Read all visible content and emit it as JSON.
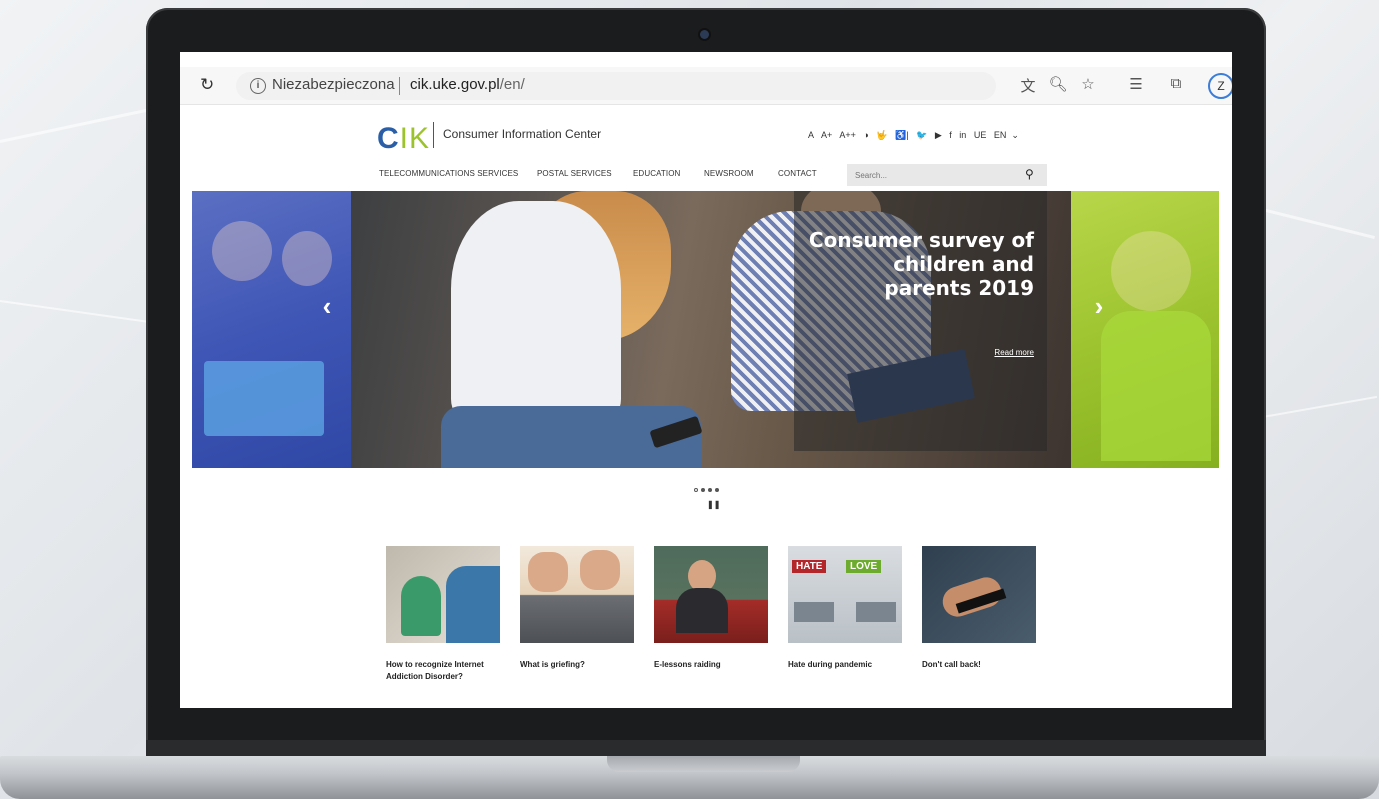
{
  "browser": {
    "security_label": "Niezabezpieczona",
    "url_host": "cik.uke.gov.pl",
    "url_path": "/en/",
    "profile_initial": "Z",
    "icons": [
      "reload-icon",
      "info-icon",
      "translate-icon",
      "zoom-icon",
      "favorite-icon",
      "favorites-list-icon",
      "collections-icon"
    ]
  },
  "site": {
    "logo_c": "C",
    "logo_ik": "IK",
    "logo_text": "Consumer Information Center",
    "tools": {
      "font_small": "A",
      "font_medium": "A+",
      "font_large": "A++",
      "contrast": "◑",
      "sign_language": "🤟",
      "wcag": "♿|",
      "social": [
        "🐦",
        "▶",
        "f",
        "in"
      ],
      "ue": "UE",
      "language": "EN"
    },
    "nav": [
      {
        "label": "TELECOMMUNICATIONS SERVICES"
      },
      {
        "label": "POSTAL SERVICES"
      },
      {
        "label": "EDUCATION"
      },
      {
        "label": "NEWSROOM"
      },
      {
        "label": "CONTACT"
      }
    ],
    "search_placeholder": "Search..."
  },
  "carousel": {
    "title": "Consumer survey of children and parents 2019",
    "read_more": "Read more",
    "prev": "‹",
    "next": "›",
    "slides_count": 4,
    "active_index": 0
  },
  "articles": [
    {
      "title": "How to recognize Internet Addiction Disorder?"
    },
    {
      "title": "What is griefing?"
    },
    {
      "title": "E-lessons raiding"
    },
    {
      "title": "Hate during pandemic"
    },
    {
      "title": "Don't call back!"
    }
  ],
  "thumb_labels": {
    "hate": "HATE",
    "love": "LOVE"
  }
}
